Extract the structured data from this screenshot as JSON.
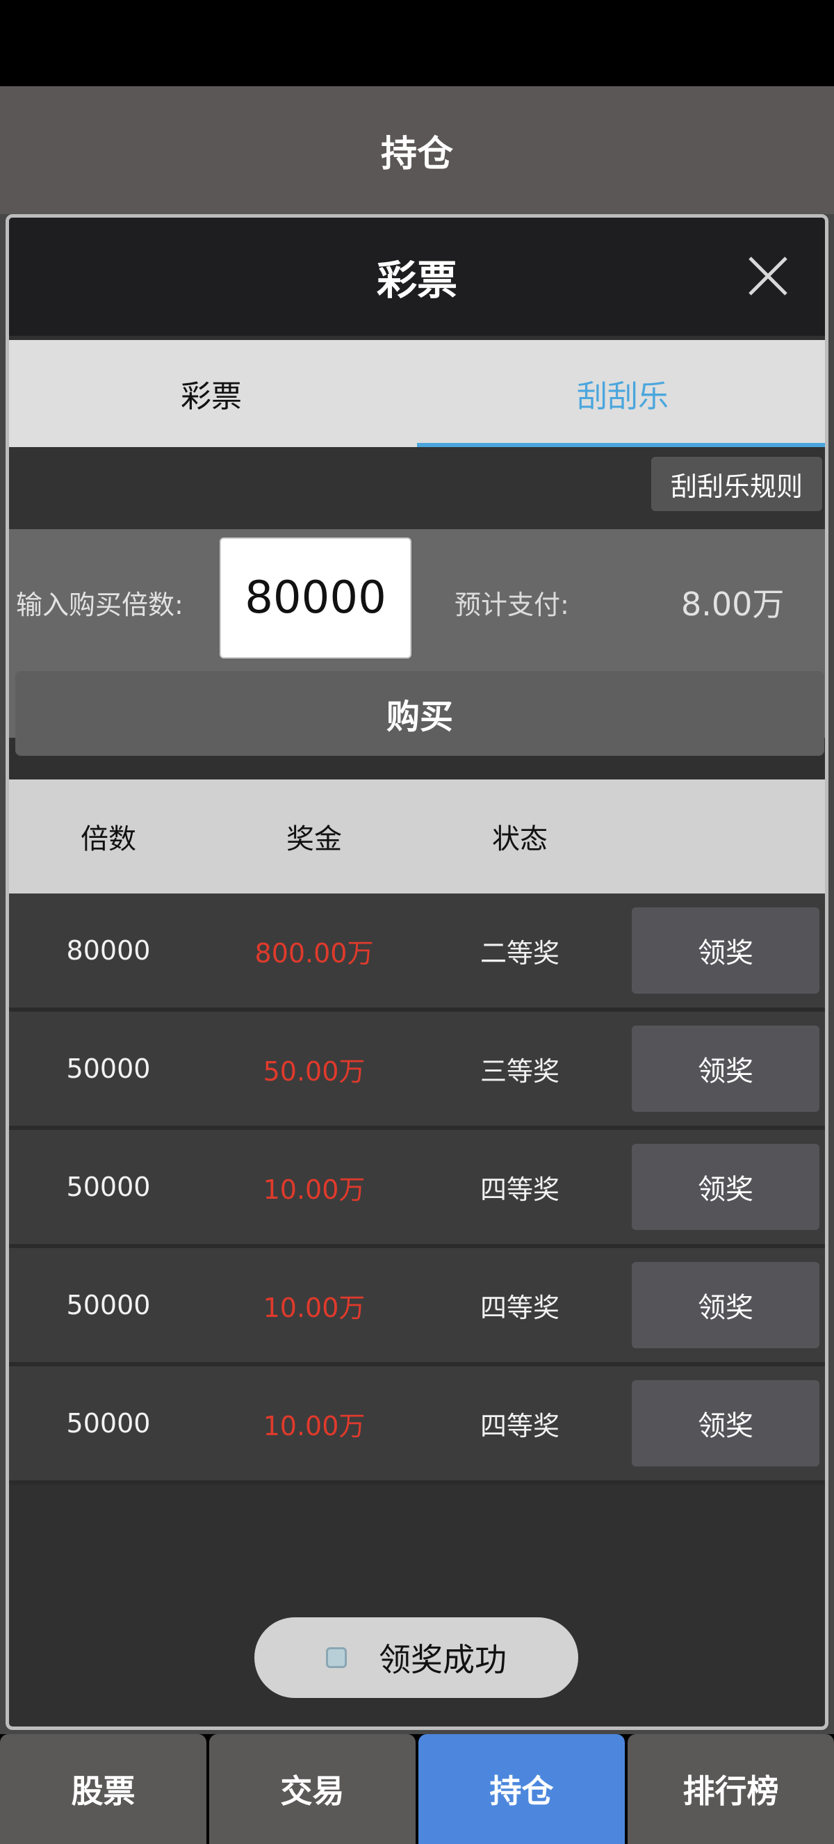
{
  "header": {
    "title": "持仓"
  },
  "modal": {
    "title": "彩票",
    "close_icon": "close-icon",
    "tabs": [
      {
        "label": "彩票",
        "active": false
      },
      {
        "label": "刮刮乐",
        "active": true
      }
    ],
    "rules_button": "刮刮乐规则",
    "buy": {
      "quantity_label": "输入购买倍数:",
      "quantity_value": "80000",
      "estimated_label": "预计支付:",
      "estimated_value": "8.00万",
      "buy_button": "购买"
    },
    "table": {
      "headers": [
        "倍数",
        "奖金",
        "状态",
        ""
      ],
      "rows": [
        {
          "multiplier": "80000",
          "prize": "800.00万",
          "status": "二等奖",
          "action": "领奖"
        },
        {
          "multiplier": "50000",
          "prize": "50.00万",
          "status": "三等奖",
          "action": "领奖"
        },
        {
          "multiplier": "50000",
          "prize": "10.00万",
          "status": "四等奖",
          "action": "领奖"
        },
        {
          "multiplier": "50000",
          "prize": "10.00万",
          "status": "四等奖",
          "action": "领奖"
        },
        {
          "multiplier": "50000",
          "prize": "10.00万",
          "status": "四等奖",
          "action": "领奖"
        }
      ]
    }
  },
  "toast": {
    "text": "领奖成功",
    "icon": "app-icon"
  },
  "bottom_nav": [
    {
      "label": "股票",
      "active": false
    },
    {
      "label": "交易",
      "active": false
    },
    {
      "label": "持仓",
      "active": true
    },
    {
      "label": "排行榜",
      "active": false
    }
  ],
  "colors": {
    "accent": "#4aa6dd",
    "nav_active": "#4c87dd",
    "prize_red": "#e03a2c"
  }
}
